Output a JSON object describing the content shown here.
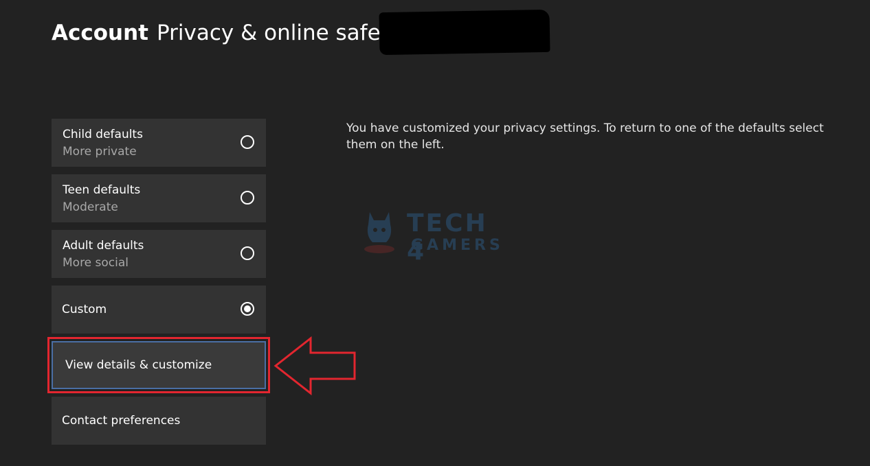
{
  "header": {
    "breadcrumb": "Account",
    "title": "Privacy & online safety"
  },
  "options": [
    {
      "label": "Child defaults",
      "sublabel": "More private",
      "selected": false
    },
    {
      "label": "Teen defaults",
      "sublabel": "Moderate",
      "selected": false
    },
    {
      "label": "Adult defaults",
      "sublabel": "More social",
      "selected": false
    },
    {
      "label": "Custom",
      "selected": true
    }
  ],
  "actions": {
    "view_details": "View details & customize",
    "contact_preferences": "Contact preferences"
  },
  "description": "You have customized your privacy settings. To return to one of the defaults select them on the left.",
  "watermark": {
    "line1": "TECH 4",
    "line2": "GAMERS"
  },
  "colors": {
    "background": "#222222",
    "tile": "#333333",
    "highlight": "#e3262f",
    "watermark": "#3aa0ff"
  }
}
